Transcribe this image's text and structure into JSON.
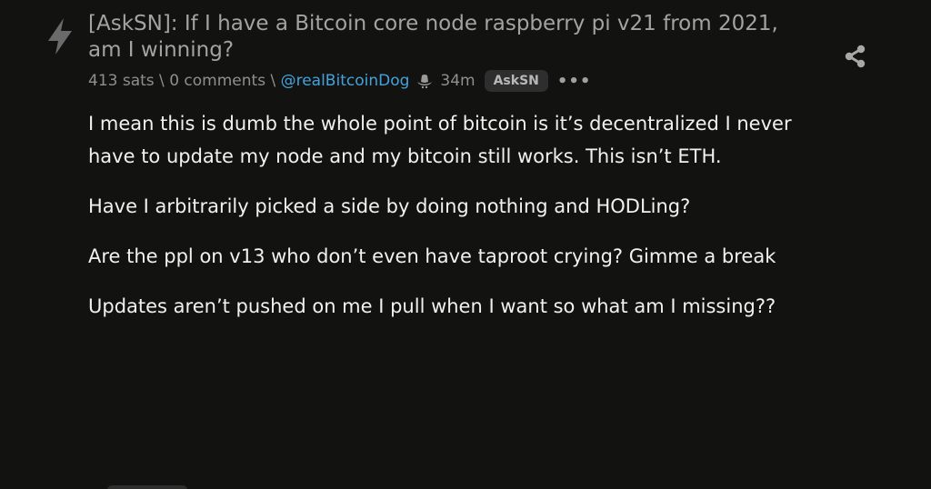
{
  "post": {
    "title": "[AskSN]: If I have a Bitcoin core node raspberry pi v21 from 2021, am I winning?",
    "sats": "413 sats",
    "sep1": " \\ ",
    "comments": "0 comments",
    "sep2": " \\ ",
    "author": "@realBitcoinDog",
    "age": "34m",
    "sub": "AskSN",
    "more": "•••",
    "paragraphs": [
      "I mean this is dumb the whole point of bitcoin is it’s decentralized I never have to update my node and my bitcoin still works. This isn’t ETH.",
      "Have I arbitrarily picked a side by doing nothing and HODLing?",
      "Are the ppl on v13 who don’t even have taproot crying? Gimme a break",
      "Updates aren’t pushed on me I pull when I want so what am I missing??"
    ]
  },
  "icons": {
    "vote": "lightning-bolt-icon",
    "author_badge": "cowboy-hat-icon",
    "share": "share-icon"
  },
  "colors": {
    "background": "#121211",
    "title": "#a3a3a3",
    "meta": "#8f8f8f",
    "link": "#43a2dc",
    "body_text": "#f1f1f1",
    "badge_bg": "#2e2e2e"
  }
}
